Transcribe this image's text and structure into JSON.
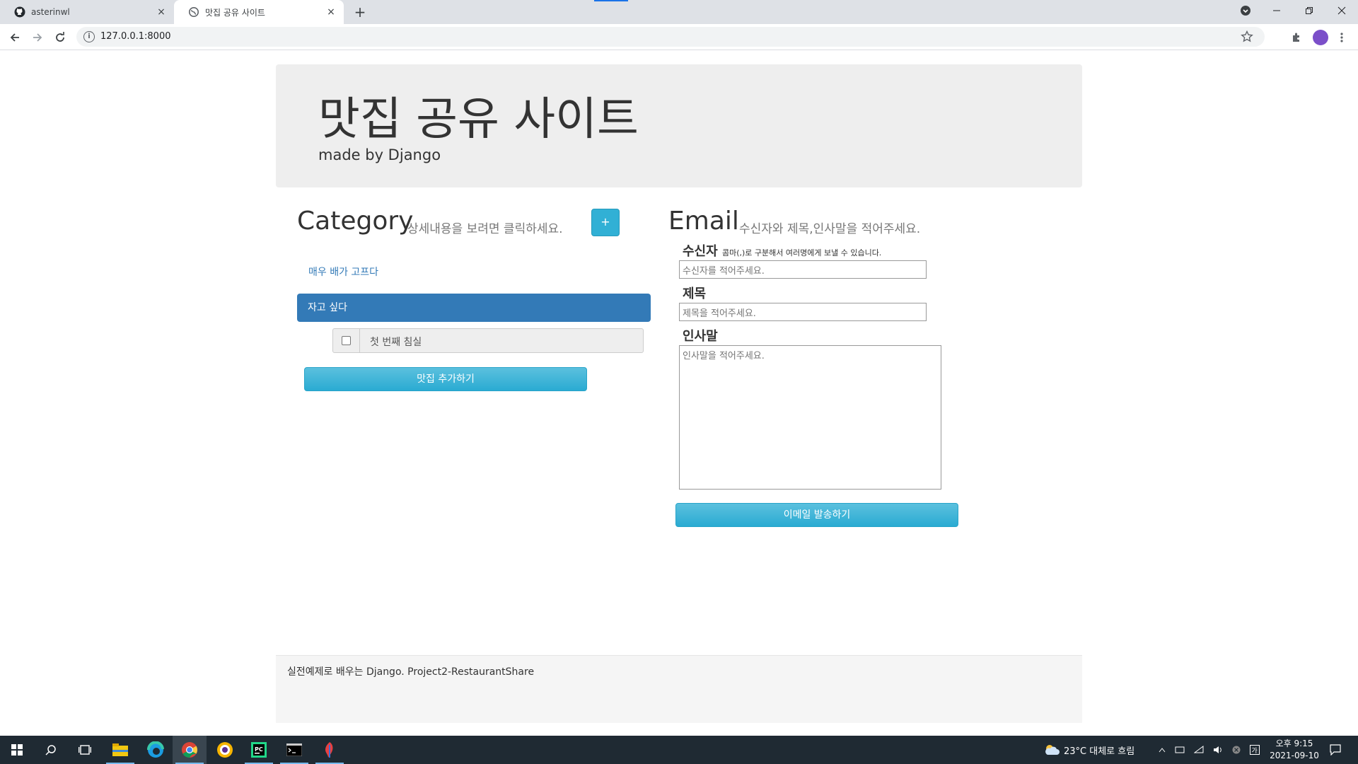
{
  "browser": {
    "tabs": [
      {
        "title": "asterinwl",
        "icon": "github-icon"
      },
      {
        "title": "맛집 공유 사이트",
        "icon": "globe-icon"
      }
    ],
    "new_tab": "+",
    "close": "×",
    "url": "127.0.0.1:8000"
  },
  "header": {
    "title": "맛집 공유 사이트",
    "subtitle": "made by Django"
  },
  "category": {
    "heading": "Category",
    "hint": "상세내용을 보려면 클릭하세요.",
    "add_button": "+",
    "link_item": "매우 배가 고프다",
    "active_item": "자고 싶다",
    "restaurant_label": "첫 번째 침실",
    "submit": "맛집 추가하기"
  },
  "email": {
    "heading": "Email",
    "hint": "수신자와 제목,인사말을 적어주세요.",
    "to_label": "수신자",
    "to_help": "콤마(,)로 구분해서 여러명에게 보낼 수 있습니다.",
    "to_placeholder": "수신자를 적어주세요.",
    "subject_label": "제목",
    "subject_placeholder": "제목을 적어주세요.",
    "greeting_label": "인사말",
    "greeting_placeholder": "인사말을 적어주세요.",
    "submit": "이메일 발송하기"
  },
  "footer": {
    "text": "실전예제로 배우는 Django. Project2-RestaurantShare"
  },
  "taskbar": {
    "weather": "23°C 대체로 흐림",
    "time": "오후 9:15",
    "date": "2021-09-10"
  },
  "colors": {
    "primary": "#337ab7",
    "info": "#5bc0de",
    "jumbotron": "#eeeeee"
  }
}
